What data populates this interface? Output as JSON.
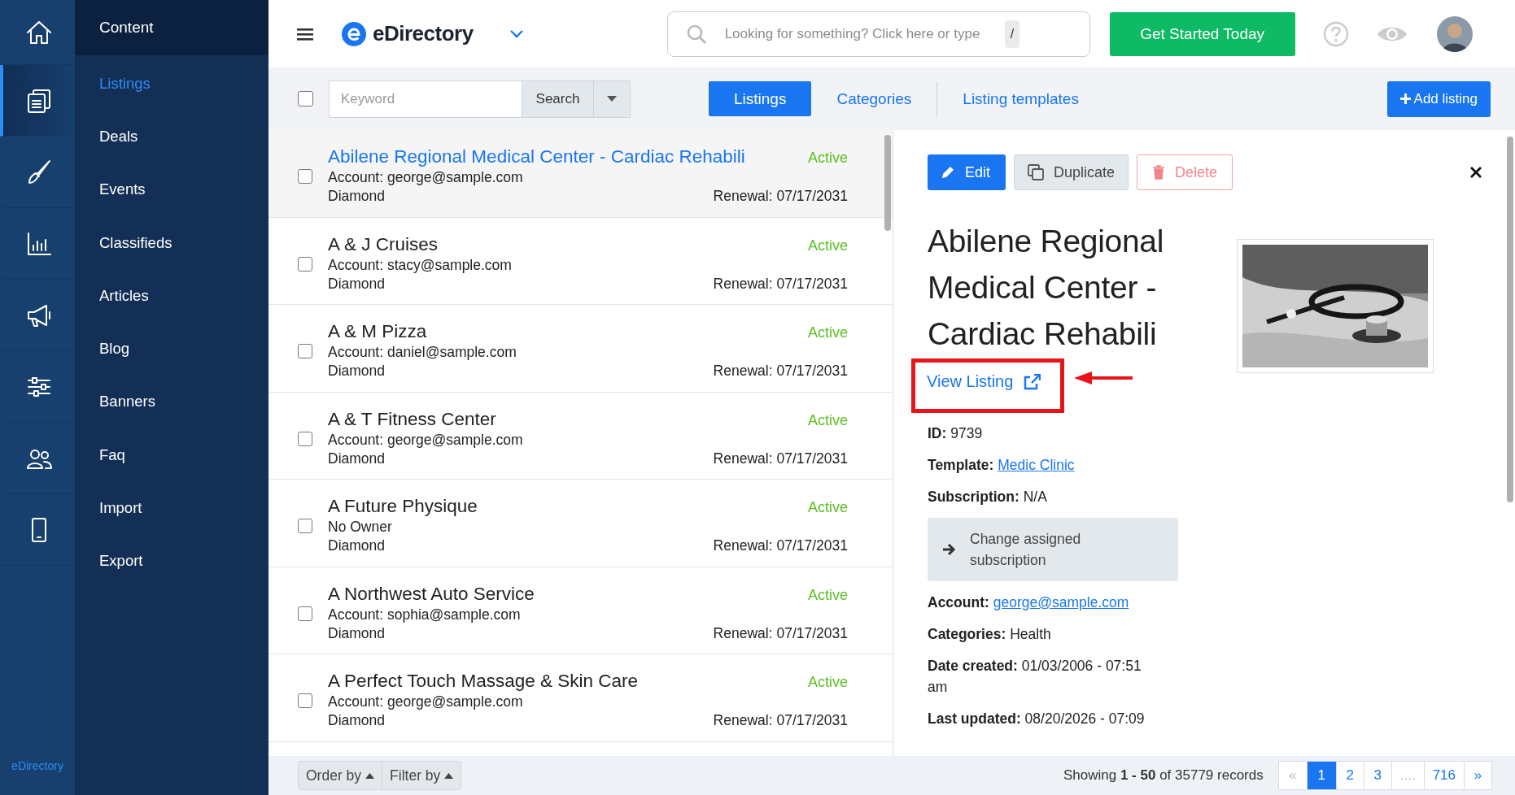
{
  "rail": {
    "items": [
      {
        "selected": false
      },
      {
        "selected": true
      },
      {
        "selected": false
      },
      {
        "selected": false
      },
      {
        "selected": false
      },
      {
        "selected": false
      },
      {
        "selected": false
      },
      {
        "selected": false
      }
    ],
    "footer": "eDirectory"
  },
  "submenu": {
    "title": "Content",
    "items": [
      {
        "label": "Listings",
        "selected": true
      },
      {
        "label": "Deals",
        "selected": false
      },
      {
        "label": "Events",
        "selected": false
      },
      {
        "label": "Classifieds",
        "selected": false
      },
      {
        "label": "Articles",
        "selected": false
      },
      {
        "label": "Blog",
        "selected": false
      },
      {
        "label": "Banners",
        "selected": false
      },
      {
        "label": "Faq",
        "selected": false
      },
      {
        "label": "Import",
        "selected": false
      },
      {
        "label": "Export",
        "selected": false
      }
    ]
  },
  "topbar": {
    "brand": "eDirectory",
    "search_placeholder": "Looking for something? Click here or type",
    "shortcut": "/",
    "cta": "Get Started Today"
  },
  "toolbar": {
    "select_all_checked": false,
    "keyword_placeholder": "Keyword",
    "search_button": "Search",
    "tabs": [
      {
        "label": "Listings",
        "selected": true
      },
      {
        "label": "Categories",
        "selected": false
      },
      {
        "label": "Listing templates",
        "selected": false
      }
    ],
    "add_button": "Add listing"
  },
  "listings": [
    {
      "title": "Abilene Regional Medical Center - Cardiac Rehabili",
      "account": "Account: george@sample.com",
      "level": "Diamond",
      "status": "Active",
      "renewal": "Renewal: 07/17/2031",
      "selected": true,
      "checked": false
    },
    {
      "title": "A & J Cruises",
      "account": "Account: stacy@sample.com",
      "level": "Diamond",
      "status": "Active",
      "renewal": "Renewal: 07/17/2031",
      "selected": false,
      "checked": false
    },
    {
      "title": "A & M Pizza",
      "account": "Account: daniel@sample.com",
      "level": "Diamond",
      "status": "Active",
      "renewal": "Renewal: 07/17/2031",
      "selected": false,
      "checked": false
    },
    {
      "title": "A & T Fitness Center",
      "account": "Account: george@sample.com",
      "level": "Diamond",
      "status": "Active",
      "renewal": "Renewal: 07/17/2031",
      "selected": false,
      "checked": false
    },
    {
      "title": "A Future Physique",
      "account": "No Owner",
      "level": "Diamond",
      "status": "Active",
      "renewal": "Renewal: 07/17/2031",
      "selected": false,
      "checked": false
    },
    {
      "title": "A Northwest Auto Service",
      "account": "Account: sophia@sample.com",
      "level": "Diamond",
      "status": "Active",
      "renewal": "Renewal: 07/17/2031",
      "selected": false,
      "checked": false
    },
    {
      "title": "A Perfect Touch Massage & Skin Care",
      "account": "Account: george@sample.com",
      "level": "Diamond",
      "status": "Active",
      "renewal": "Renewal: 07/17/2031",
      "selected": false,
      "checked": false
    }
  ],
  "detail": {
    "buttons": [
      {
        "label": "Edit",
        "kind": "primary"
      },
      {
        "label": "Duplicate",
        "kind": "secondary"
      },
      {
        "label": "Delete",
        "kind": "danger"
      }
    ],
    "title": "Abilene Regional Medical Center - Cardiac Rehabili",
    "view_link": "View Listing",
    "fields": [
      {
        "kind": "text",
        "label": "ID:",
        "value": "9739"
      },
      {
        "kind": "link",
        "label": "Template:",
        "value": "Medic Clinic"
      },
      {
        "kind": "text",
        "label": "Subscription:",
        "value": "N/A"
      },
      {
        "kind": "action",
        "label": "Change assigned subscription"
      },
      {
        "kind": "link",
        "label": "Account:",
        "value": "george@sample.com"
      },
      {
        "kind": "text",
        "label": "Categories:",
        "value": "Health"
      },
      {
        "kind": "text",
        "label": "Date created:",
        "value": "01/03/2006 - 07:51 am"
      },
      {
        "kind": "text",
        "label": "Last updated:",
        "value": "08/20/2026 - 07:09"
      }
    ]
  },
  "footer": {
    "order_by": "Order by",
    "filter_by": "Filter by",
    "showing": "Showing **1 - 50** of 35779 records",
    "pages": [
      {
        "label": "«",
        "selected": false,
        "disabled": true
      },
      {
        "label": "1",
        "selected": true,
        "disabled": false
      },
      {
        "label": "2",
        "selected": false,
        "disabled": false
      },
      {
        "label": "3",
        "selected": false,
        "disabled": false
      },
      {
        "label": "....",
        "selected": false,
        "disabled": true
      },
      {
        "label": "716",
        "selected": false,
        "disabled": false
      },
      {
        "label": "»",
        "selected": false,
        "disabled": false
      }
    ]
  }
}
